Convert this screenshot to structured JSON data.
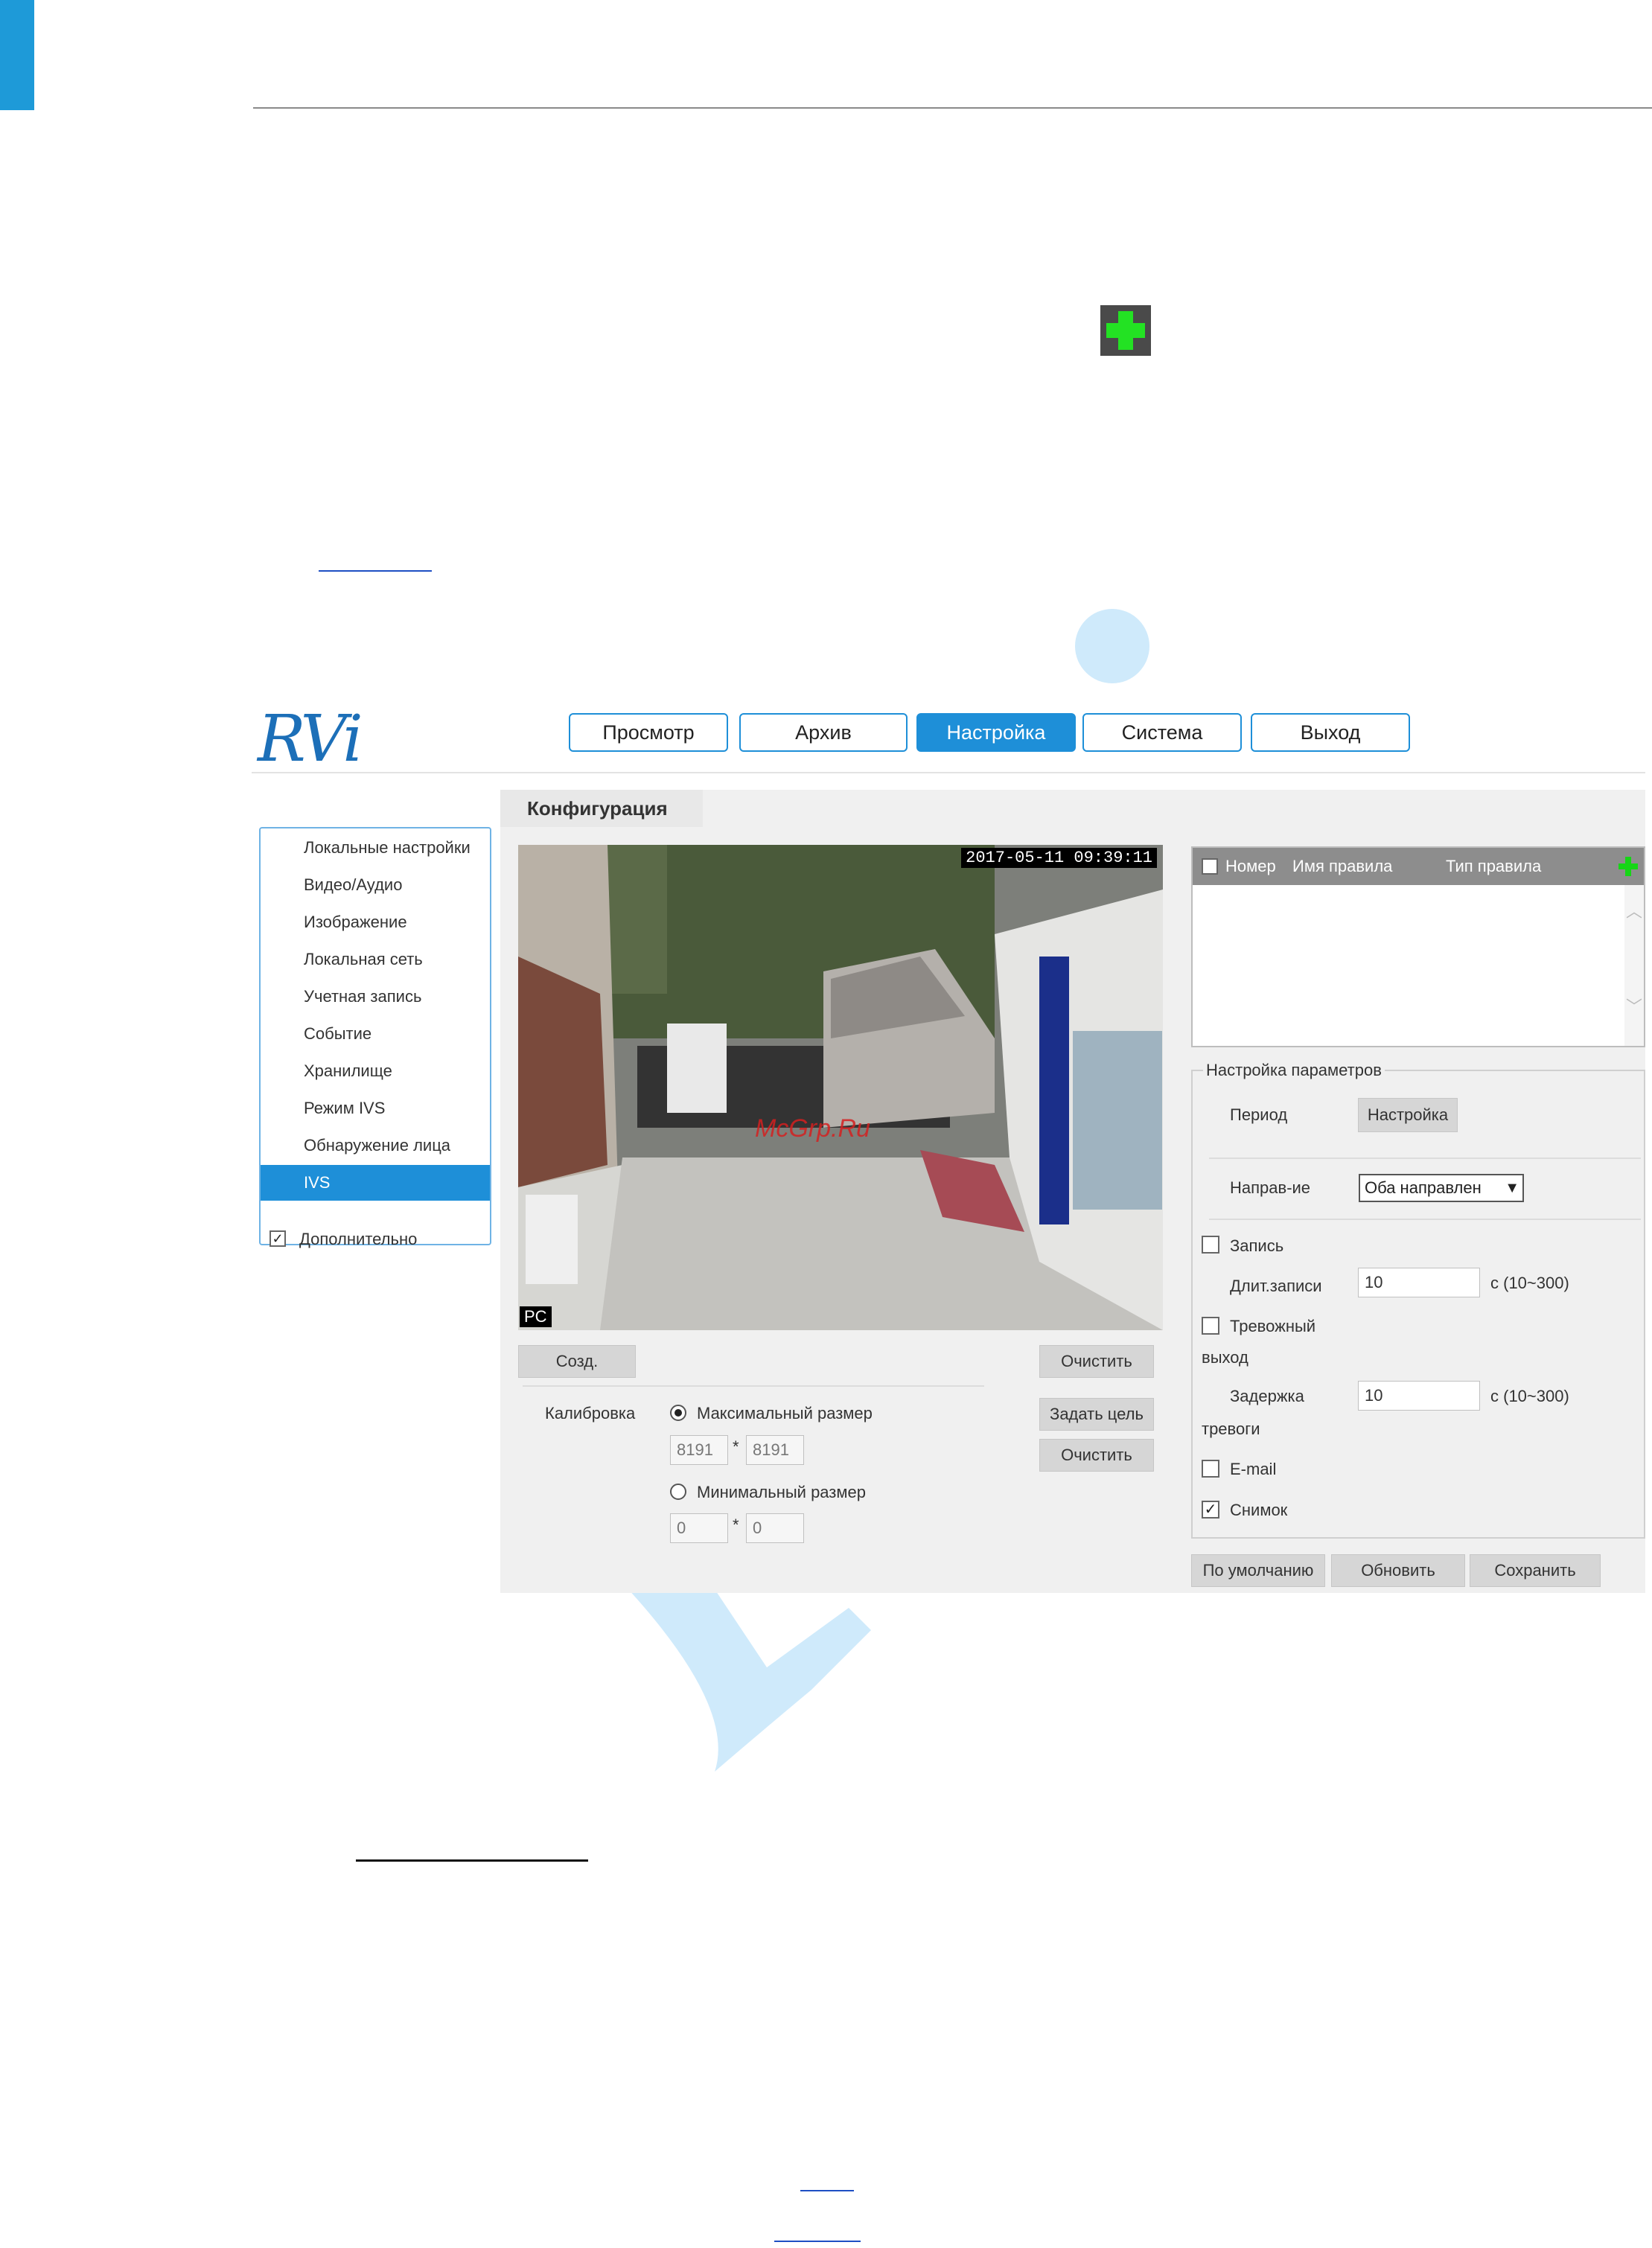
{
  "nav": {
    "preview": "Просмотр",
    "archive": "Архив",
    "settings": "Настройка",
    "system": "Система",
    "logout": "Выход"
  },
  "logo_text": "RVi",
  "config_tab": "Конфигурация",
  "sidebar": {
    "items": [
      {
        "label": "Локальные настройки"
      },
      {
        "label": "Видео/Аудио"
      },
      {
        "label": "Изображение"
      },
      {
        "label": "Локальная сеть"
      },
      {
        "label": "Учетная запись"
      },
      {
        "label": "Событие"
      },
      {
        "label": "Хранилище"
      },
      {
        "label": "Режим IVS"
      },
      {
        "label": "Обнаружение лица"
      },
      {
        "label": "IVS"
      }
    ],
    "active_index": 9,
    "extra": {
      "label": "Дополнительно",
      "checked": true
    }
  },
  "video": {
    "timestamp": "2017-05-11 09:39:11",
    "corner_label": "PC",
    "watermark": "McGrp.Ru"
  },
  "video_controls": {
    "create": "Созд.",
    "clear": "Очистить",
    "set_target": "Задать цель",
    "clear2": "Очистить"
  },
  "calibration": {
    "label": "Калибровка",
    "max_label": "Максимальный размер",
    "max_w": "8191",
    "max_h": "8191",
    "min_label": "Минимальный размер",
    "min_w": "0",
    "min_h": "0",
    "times": "*"
  },
  "rules_table": {
    "columns": [
      "Номер",
      "Имя правила",
      "Тип правила"
    ]
  },
  "params": {
    "title": "Настройка параметров",
    "period_label": "Период",
    "period_button": "Настройка",
    "direction_label": "Направ-ие",
    "direction_value": "Оба направлен",
    "record_label": "Запись",
    "record_duration_label": "Длит.записи",
    "record_duration_value": "10",
    "record_range": "с (10~300)",
    "alarm_out_label1": "Тревожный",
    "alarm_out_label2": "выход",
    "alarm_delay_label1": "Задержка",
    "alarm_delay_label2": "тревоги",
    "alarm_delay_value": "10",
    "alarm_delay_range": "с (10~300)",
    "email_label": "E-mail",
    "snapshot_label": "Снимок",
    "snapshot_checked": true
  },
  "footer_buttons": {
    "default": "По умолчанию",
    "refresh": "Обновить",
    "save": "Сохранить"
  }
}
